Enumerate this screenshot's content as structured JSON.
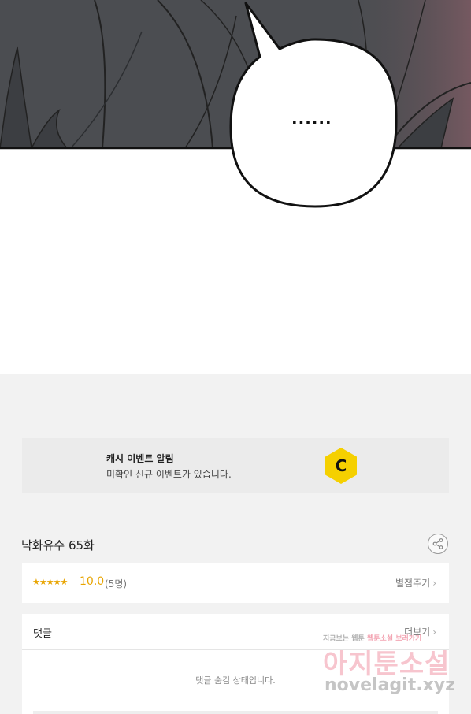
{
  "comic": {
    "bubble_text": "......"
  },
  "event": {
    "title": "캐시 이벤트 알림",
    "subtitle": "미확인 신규 이벤트가 있습니다.",
    "coin_letter": "C"
  },
  "episode": {
    "title": "낙화유수 65화"
  },
  "rating": {
    "stars": "★★★★★",
    "score": "10.0",
    "count": "(5명)",
    "rate_link": "별점주기"
  },
  "comments": {
    "title": "댓글",
    "more": "더보기",
    "hidden_message": "댓글 숨김 상태입니다."
  },
  "watermark": {
    "tagline_a": "지금보는 웹툰 ",
    "tagline_b": "웹툰소설 보러가기",
    "brand": "아지툰소설",
    "url": "novelagit.xyz"
  },
  "colors": {
    "accent": "#e8a400",
    "coin": "#f5d000",
    "comic_dark": "#4b4d51"
  }
}
